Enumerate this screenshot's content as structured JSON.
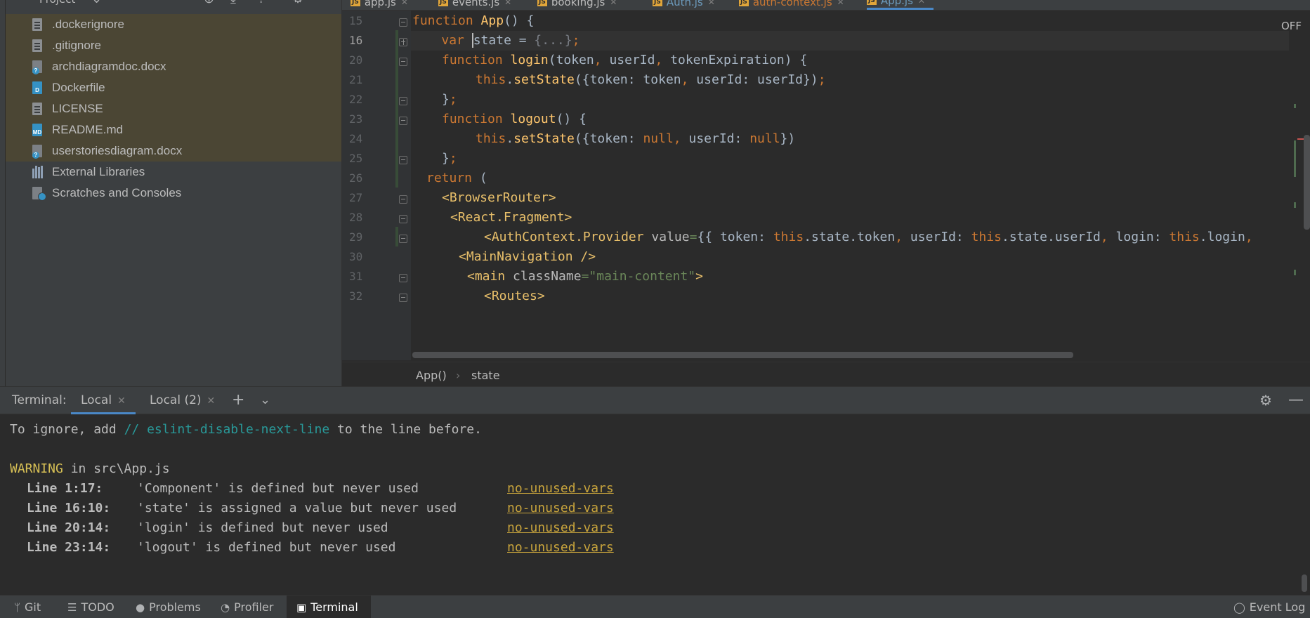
{
  "project": {
    "title": "Project",
    "files": [
      {
        "name": ".dockerignore",
        "icon": "text-file-icon"
      },
      {
        "name": ".gitignore",
        "icon": "gitignore-file-icon"
      },
      {
        "name": "archdiagramdoc.docx",
        "icon": "docx-file-icon"
      },
      {
        "name": "Dockerfile",
        "icon": "docker-file-icon"
      },
      {
        "name": "LICENSE",
        "icon": "text-file-icon"
      },
      {
        "name": "README.md",
        "icon": "markdown-file-icon"
      },
      {
        "name": "userstoriesdiagram.docx",
        "icon": "docx-file-icon"
      },
      {
        "name": "External Libraries",
        "icon": "library-icon"
      },
      {
        "name": "Scratches and Consoles",
        "icon": "scratch-icon"
      }
    ]
  },
  "editor": {
    "tabs": [
      {
        "label": "app.js"
      },
      {
        "label": "events.js"
      },
      {
        "label": "booking.js"
      },
      {
        "label": "Auth.js"
      },
      {
        "label": "auth-context.js"
      },
      {
        "label": "App.js",
        "active": true
      }
    ],
    "line_numbers": [
      "15",
      "16",
      "20",
      "21",
      "22",
      "23",
      "24",
      "25",
      "26",
      "27",
      "28",
      "29",
      "30",
      "31",
      "32"
    ],
    "off_label": "OFF",
    "breadcrumbs": [
      "App()",
      "state"
    ]
  },
  "terminal": {
    "label": "Terminal:",
    "tabs": [
      "Local",
      "Local (2)"
    ],
    "ignore_line": {
      "prefix": "To ignore, add ",
      "comment": "// eslint-disable-next-line",
      "suffix": " to the line before."
    },
    "warning": {
      "word": "WARNING",
      "rest": " in src\\App.js"
    },
    "warnings": [
      {
        "line": "Line 1:17:",
        "message": "'Component' is defined but never used",
        "rule": "no-unused-vars"
      },
      {
        "line": "Line 16:10:",
        "message": "'state' is assigned a value but never used",
        "rule": "no-unused-vars"
      },
      {
        "line": "Line 20:14:",
        "message": "'login' is defined but never used",
        "rule": "no-unused-vars"
      },
      {
        "line": "Line 23:14:",
        "message": "'logout' is defined but never used",
        "rule": "no-unused-vars"
      }
    ]
  },
  "status_bar": {
    "items": [
      {
        "label": "Git",
        "icon": "git-branch-icon"
      },
      {
        "label": "TODO",
        "icon": "list-icon"
      },
      {
        "label": "Problems",
        "icon": "alert-icon"
      },
      {
        "label": "Profiler",
        "icon": "profiler-icon"
      },
      {
        "label": "Terminal",
        "icon": "terminal-icon",
        "active": true
      }
    ],
    "event_log": "Event Log"
  },
  "colors": {
    "background": "#2b2b2b",
    "panel": "#3c3f41",
    "keyword": "#cc7832",
    "function": "#ffc66d",
    "string": "#6a8759",
    "accent": "#4a88c7",
    "warning": "#d6bf55"
  }
}
